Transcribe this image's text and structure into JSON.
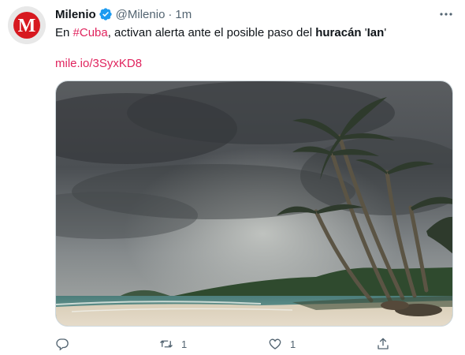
{
  "tweet": {
    "author_name": "Milenio",
    "handle": "@Milenio",
    "separator": "·",
    "time": "1m",
    "avatar_letter": "M",
    "text_before": "En ",
    "hashtag": "#Cuba",
    "text_middle": ", activan alerta ante el posible paso del ",
    "bold_word": "huracán",
    "text_quote_open": " '",
    "bold_name": "Ian",
    "text_quote_close": "'",
    "link": "mile.io/3SyxKD8",
    "replies": "",
    "retweets": "1",
    "likes": "1"
  },
  "colors": {
    "accent": "#e0245e",
    "verified": "#1d9bf0",
    "muted": "#536471",
    "brand_red": "#d71920"
  },
  "icons": {
    "reply": "reply-icon",
    "retweet": "retweet-icon",
    "like": "heart-icon",
    "share": "share-icon",
    "more": "more-icon",
    "verified": "verified-badge-icon"
  }
}
